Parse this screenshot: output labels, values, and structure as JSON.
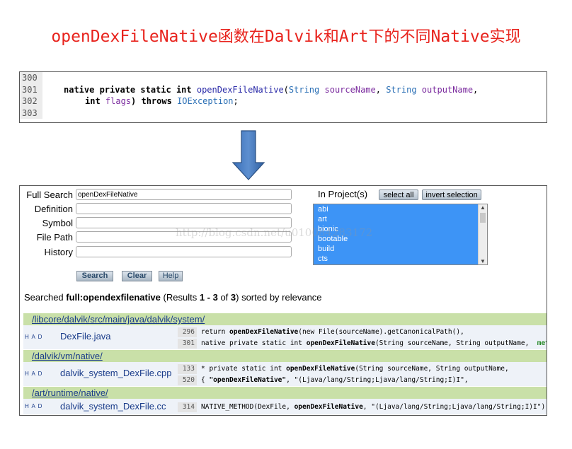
{
  "title": {
    "part1": "openDexFileNative",
    "cjk1": "函数在",
    "part2": "Dalvik",
    "cjk2": "和",
    "part3": "Art",
    "cjk3": "下的不同",
    "part4": "Native",
    "cjk4": "实现"
  },
  "code": {
    "lines": [
      {
        "n": "300"
      },
      {
        "n": "301",
        "t1": "native private static int ",
        "fn": "openDexFileNative",
        "t2": "(",
        "ty1": "String",
        "t3": " ",
        "p1": "sourceName",
        "t4": ", ",
        "ty2": "String",
        "t5": " ",
        "p2": "outputName",
        "t6": ","
      },
      {
        "n": "302",
        "t1": "int ",
        "p1": "flags",
        "t2": ") throws ",
        "ty1": "IOException",
        "t3": ";"
      },
      {
        "n": "303"
      }
    ]
  },
  "form": {
    "full_search_label": "Full Search",
    "full_search_value": "openDexFileNative",
    "definition_label": "Definition",
    "symbol_label": "Symbol",
    "file_path_label": "File Path",
    "history_label": "History",
    "in_project_label": "In Project(s)",
    "select_all": "select all",
    "invert_selection": "invert selection",
    "projects": [
      "abi",
      "art",
      "bionic",
      "bootable",
      "build",
      "cts"
    ],
    "search_btn": "Search",
    "clear_btn": "Clear",
    "help_btn": "Help"
  },
  "summary": {
    "prefix": "Searched ",
    "query": "full:opendexfilenative",
    "mid": " (Results ",
    "range": "1 - 3",
    "of": " of ",
    "total": "3",
    "suffix": ") sorted by relevance"
  },
  "results": [
    {
      "dir": "/libcore/dalvik/src/main/java/dalvik/system/",
      "had": "H A D",
      "file": "DexFile.java",
      "hits": [
        {
          "ln": "296",
          "pre": "return ",
          "b": "openDexFileNative",
          "post": "(new File(sourceName).getCanonicalPath(),"
        },
        {
          "ln": "301",
          "pre": "native private static int ",
          "b": "openDexFileNative",
          "post": "(String sourceName, String outputName,  ",
          "extra": "met"
        }
      ]
    },
    {
      "dir": "/dalvik/vm/native/",
      "had": "H A D",
      "file": "dalvik_system_DexFile.cpp",
      "hits": [
        {
          "ln": "133",
          "pre": "* private static int ",
          "b": "openDexFileNative",
          "post": "(String sourceName, String outputName,"
        },
        {
          "ln": "520",
          "pre": "{ ",
          "b": "\"openDexFileNative\"",
          "post": ", \"(Ljava/lang/String;Ljava/lang/String;I)I\","
        }
      ]
    },
    {
      "dir": "/art/runtime/native/",
      "had": "H A D",
      "file": "dalvik_system_DexFile.cc",
      "hits": [
        {
          "ln": "314",
          "pre": "NATIVE_METHOD(DexFile, ",
          "b": "openDexFileNative",
          "post": ", \"(Ljava/lang/String;Ljava/lang/String;I)I\"),"
        }
      ]
    }
  ],
  "watermark": "http://blog.csdn.net/u010084283172"
}
